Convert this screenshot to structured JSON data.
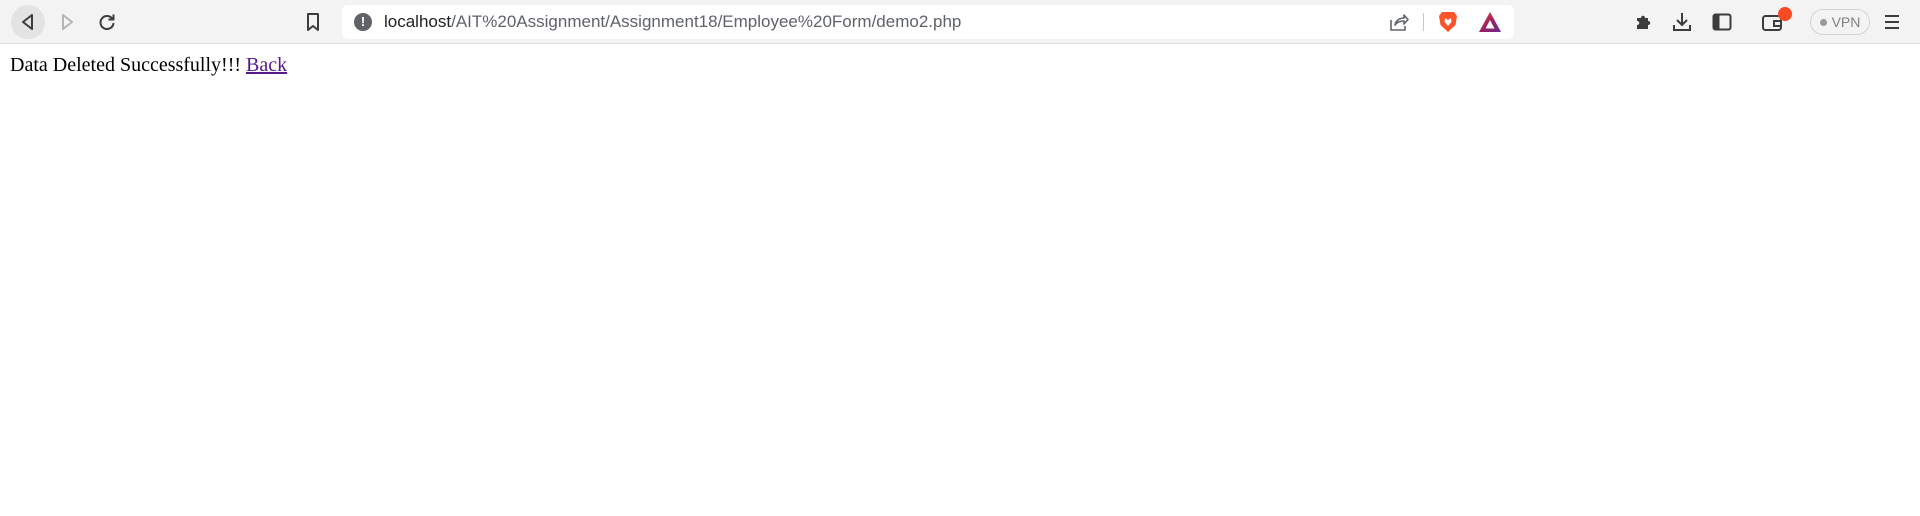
{
  "browser": {
    "url_host": "localhost",
    "url_path": "/AIT%20Assignment/Assignment18/Employee%20Form/demo2.php",
    "security_icon": "!",
    "vpn_label": "VPN",
    "icons": [
      "back-icon",
      "forward-icon",
      "reload-icon",
      "bookmark-icon",
      "site-info-icon",
      "share-icon",
      "brave-shields-icon",
      "brave-rewards-icon",
      "extensions-icon",
      "downloads-icon",
      "sidebar-icon",
      "wallet-icon",
      "vpn-icon",
      "menu-icon"
    ],
    "colors": {
      "toolbar_bg": "#f3f3f3",
      "brave_orange": "#fb542b",
      "notification_red": "#fa4a24",
      "visited_link": "#551a8b"
    }
  },
  "page": {
    "message": "Data Deleted Successfully!!!",
    "back_link": "Back"
  }
}
